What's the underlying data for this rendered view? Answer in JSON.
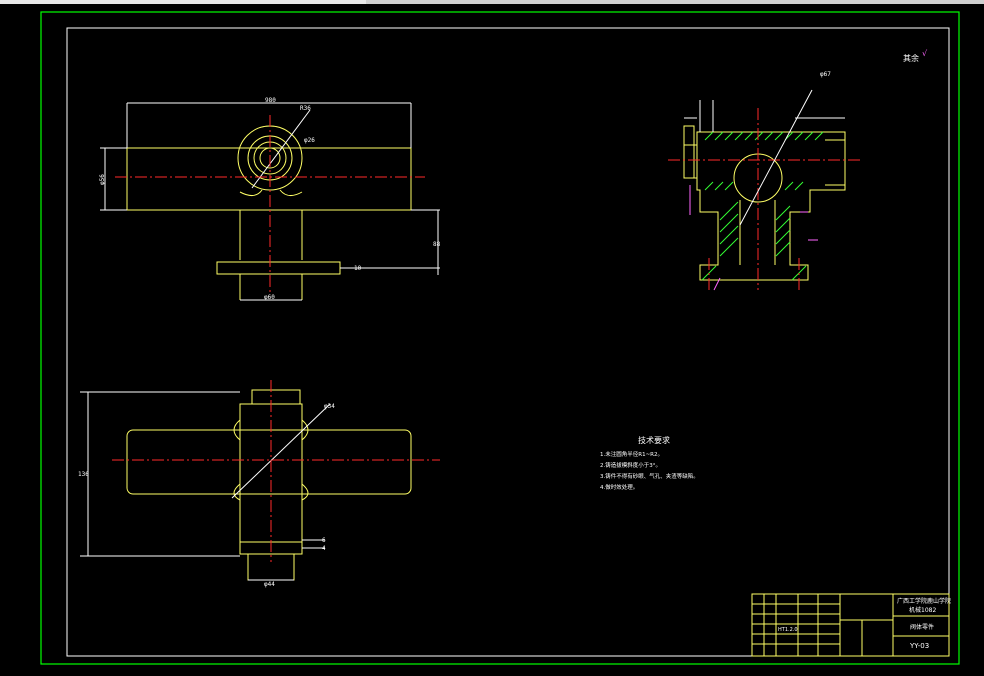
{
  "drawing": {
    "roughness_note": "其余",
    "dimensions": {
      "top_width": "980",
      "top_height": "φ56",
      "top_dim_a": "R36",
      "top_dim_b": "φ26",
      "vertical_right": "88",
      "flange_thk": "10",
      "stem_dia": "φ60",
      "section_dia": "φ67",
      "bottom_dia": "φ34",
      "bottom_height": "136",
      "bottom_flange_a": "6",
      "bottom_flange_b": "4",
      "bottom_width": "φ44"
    },
    "technical_requirements": {
      "title": "技术要求",
      "items": [
        "1.未注圆角半径R1~R2。",
        "2.铸造拔模斜度小于3°。",
        "3.铸件不得有砂眼、气孔、夹渣等缺陷。",
        "4.做时效处理。"
      ]
    },
    "title_block": {
      "school": "广西工学院鹿山学院",
      "class": "机械1082",
      "part_name": "阀体零件",
      "drawing_no": "YY-03",
      "scale_cell": "HT1.2.0"
    }
  },
  "colors": {
    "background": "#000000",
    "border": "#00ff00",
    "outline": "#ffff66",
    "centerline": "#ff2a2a",
    "dimension": "#ffffff",
    "hatch": "#33ff33",
    "leader": "#ff66ff",
    "frame_white": "#ffffff"
  }
}
